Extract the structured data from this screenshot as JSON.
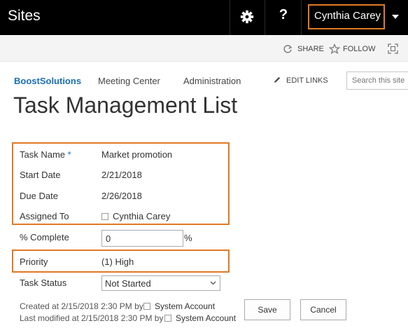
{
  "suitebar": {
    "title": "Sites",
    "settings_icon": "gear-icon",
    "help_icon": "?",
    "user_name": "Cynthia Carey",
    "user_menu_icon": "caret-down-icon",
    "highlight_color": "#e07a22"
  },
  "ribbon": {
    "share_label": "SHARE",
    "follow_label": "FOLLOW",
    "focus_icon": "focus-content-icon"
  },
  "nav": {
    "site_name": "BoostSolutions",
    "items": [
      "Meeting Center",
      "Administration"
    ],
    "edit_links_label": "EDIT LINKS",
    "search_placeholder": "Search this site"
  },
  "page_title": "Task Management List",
  "form": {
    "task_name": {
      "label": "Task Name",
      "required_mark": "*",
      "value": "Market promotion"
    },
    "start_date": {
      "label": "Start Date",
      "value": "2/21/2018"
    },
    "due_date": {
      "label": "Due Date",
      "value": "2/26/2018"
    },
    "assigned_to": {
      "label": "Assigned To",
      "value": "Cynthia Carey"
    },
    "percent_complete": {
      "label": "% Complete",
      "value": "0",
      "unit": "%"
    },
    "priority": {
      "label": "Priority",
      "value": "(1) High"
    },
    "task_status": {
      "label": "Task Status",
      "value": "Not Started"
    }
  },
  "footer": {
    "created_text": "Created at 2/15/2018 2:30 PM  by",
    "created_by": "System Account",
    "modified_text": "Last modified at 2/15/2018 2:30 PM  by",
    "modified_by": "System Account",
    "save_label": "Save",
    "cancel_label": "Cancel"
  }
}
